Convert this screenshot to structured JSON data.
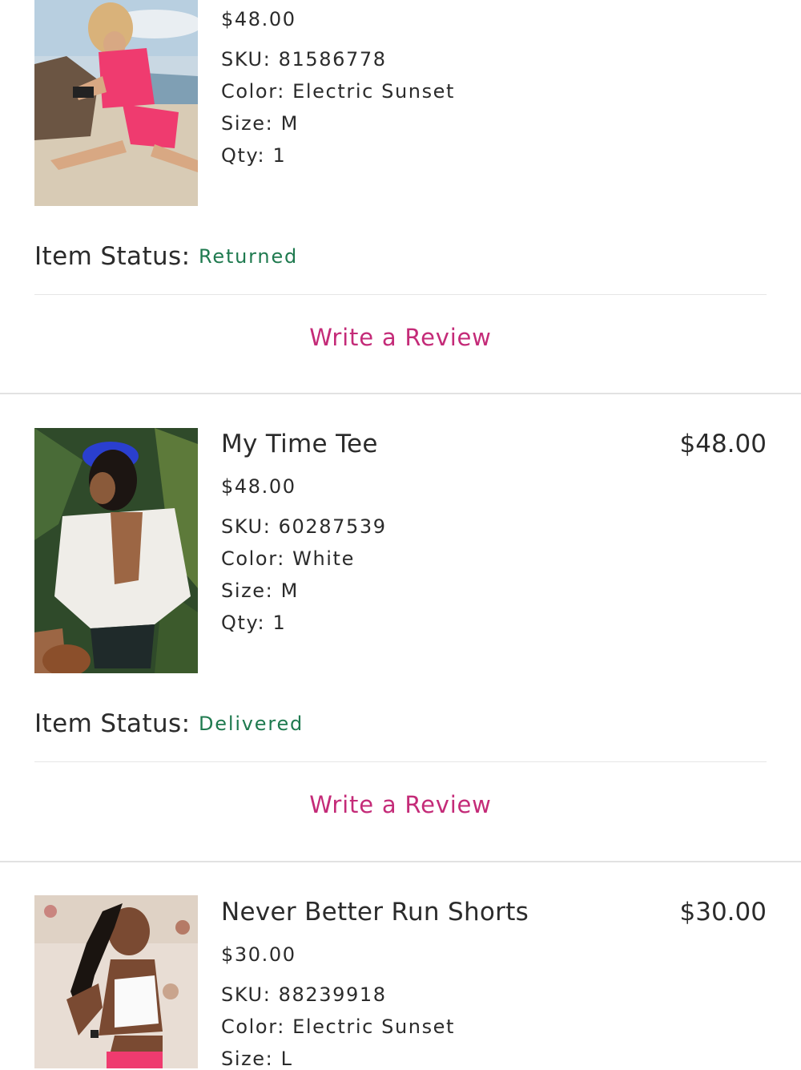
{
  "items": [
    {
      "name": "",
      "total": "",
      "unit_price": "$48.00",
      "sku": "SKU: 81586778",
      "color": "Color: Electric Sunset",
      "size": "Size: M",
      "qty": "Qty: 1",
      "status_label": "Item Status:",
      "status_value": "Returned",
      "review_label": "Write a Review",
      "status_color": "#1f7a4f"
    },
    {
      "name": "My Time Tee",
      "total": "$48.00",
      "unit_price": "$48.00",
      "sku": "SKU: 60287539",
      "color": "Color: White",
      "size": "Size: M",
      "qty": "Qty: 1",
      "status_label": "Item Status:",
      "status_value": "Delivered",
      "review_label": "Write a Review",
      "status_color": "#1f7a4f"
    },
    {
      "name": "Never Better Run Shorts",
      "total": "$30.00",
      "unit_price": "$30.00",
      "sku": "SKU: 88239918",
      "color": "Color: Electric Sunset",
      "size": "Size: L"
    }
  ],
  "accent_color": "#c42b78"
}
